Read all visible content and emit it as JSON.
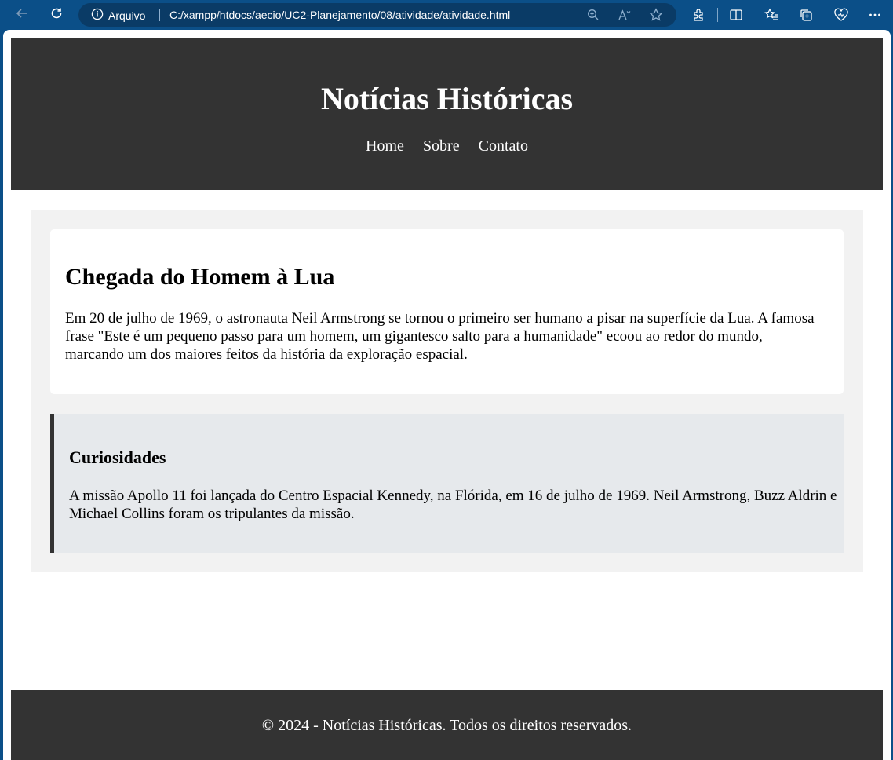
{
  "browser": {
    "security_label": "Arquivo",
    "url": "C:/xampp/htdocs/aecio/UC2-Planejamento/08/atividade/atividade.html",
    "accent_color": "#0b4f88"
  },
  "header": {
    "title": "Notícias Históricas",
    "nav": [
      "Home",
      "Sobre",
      "Contato"
    ],
    "background": "#333333"
  },
  "article": {
    "title": "Chegada do Homem à Lua",
    "body": "Em 20 de julho de 1969, o astronauta Neil Armstrong se tornou o primeiro ser humano a pisar na superfície da Lua. A famosa frase \"Este é um pequeno passo para um homem, um gigantesco salto para a humanidade\" ecoou ao redor do mundo, marcando um dos maiores feitos da história da exploração espacial."
  },
  "aside": {
    "title": "Curiosidades",
    "body": "A missão Apollo 11 foi lançada do Centro Espacial Kennedy, na Flórida, em 16 de julho de 1969. Neil Armstrong, Buzz Aldrin e Michael Collins foram os tripulantes da missão."
  },
  "footer": {
    "text": "© 2024 - Notícias Históricas. Todos os direitos reservados."
  }
}
